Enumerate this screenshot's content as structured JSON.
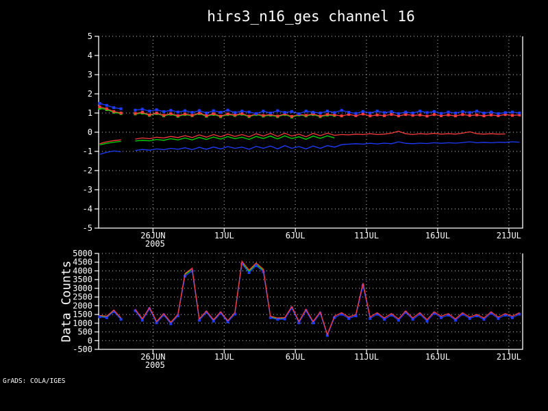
{
  "title": "hirs3_n16_ges channel 16",
  "credit": "GrADS: COLA/IGES",
  "colors": {
    "background": "#000000",
    "foreground": "#ffffff",
    "grid": "#c8c8c8",
    "red": "#fa3c3c",
    "green": "#00dc00",
    "blue": "#1e3cff"
  },
  "chart_data": [
    {
      "type": "line",
      "title": "hirs3_n16_ges channel 16",
      "panel": "top",
      "grid": true,
      "legend": "none",
      "x_axis": {
        "tick_labels": [
          "26JUN",
          "1JUL",
          "6JUL",
          "11JUL",
          "16JUL",
          "21JUL"
        ],
        "tick_times": [
          0,
          5,
          10,
          15,
          20,
          25
        ],
        "year_label": "2005",
        "t_start": -3.75,
        "dt": 0.5
      },
      "y_axis": {
        "min": -5,
        "max": 5,
        "step": 1,
        "label": ""
      },
      "series": [
        {
          "name": "green-lower-line",
          "color": "#00dc00",
          "markers": false,
          "values": [
            -0.66,
            -0.58,
            -0.52,
            -0.48,
            null,
            -0.46,
            -0.42,
            -0.45,
            -0.38,
            -0.42,
            -0.34,
            -0.4,
            -0.3,
            -0.4,
            -0.27,
            -0.38,
            -0.25,
            -0.36,
            -0.23,
            -0.34,
            -0.26,
            -0.38,
            -0.22,
            -0.33,
            -0.2,
            -0.35,
            -0.19,
            -0.33,
            -0.24,
            -0.37,
            -0.2,
            -0.32,
            -0.19,
            -0.3
          ]
        },
        {
          "name": "red-lower-line",
          "color": "#fa3c3c",
          "markers": false,
          "values": [
            -0.6,
            -0.5,
            -0.44,
            -0.4,
            null,
            -0.36,
            -0.3,
            -0.34,
            -0.26,
            -0.3,
            -0.22,
            -0.28,
            -0.18,
            -0.28,
            -0.14,
            -0.26,
            -0.12,
            -0.24,
            -0.1,
            -0.22,
            -0.12,
            -0.24,
            -0.08,
            -0.2,
            -0.06,
            -0.22,
            -0.05,
            -0.2,
            -0.1,
            -0.24,
            -0.06,
            -0.18,
            -0.05,
            -0.16,
            -0.12,
            -0.14,
            -0.1,
            -0.12,
            -0.08,
            -0.12,
            -0.1,
            -0.05,
            0.05,
            -0.08,
            -0.12,
            -0.08,
            -0.1,
            -0.06,
            -0.1,
            -0.08,
            -0.1,
            -0.05,
            0.02,
            -0.08,
            -0.1,
            -0.08,
            -0.1,
            -0.09
          ]
        },
        {
          "name": "blue-lower-line",
          "color": "#1e3cff",
          "markers": false,
          "values": [
            -1.15,
            -1.05,
            -0.98,
            -1.02,
            null,
            -0.95,
            -0.9,
            -0.94,
            -0.87,
            -0.91,
            -0.84,
            -0.89,
            -0.81,
            -0.91,
            -0.79,
            -0.89,
            -0.77,
            -0.87,
            -0.75,
            -0.84,
            -0.78,
            -0.89,
            -0.74,
            -0.84,
            -0.72,
            -0.87,
            -0.7,
            -0.84,
            -0.75,
            -0.87,
            -0.72,
            -0.84,
            -0.7,
            -0.78,
            -0.65,
            -0.62,
            -0.6,
            -0.62,
            -0.58,
            -0.61,
            -0.57,
            -0.6,
            -0.5,
            -0.58,
            -0.6,
            -0.57,
            -0.59,
            -0.55,
            -0.58,
            -0.55,
            -0.57,
            -0.54,
            -0.5,
            -0.55,
            -0.53,
            -0.55,
            -0.52,
            -0.53,
            -0.5,
            -0.52
          ]
        },
        {
          "name": "green-upper-line",
          "color": "#00dc00",
          "markers": true,
          "values": [
            1.25,
            1.18,
            1.04,
            0.97,
            null,
            0.95,
            1.0,
            0.88,
            0.97,
            0.85,
            0.94,
            0.83,
            0.92,
            0.86,
            0.97,
            0.83,
            0.93,
            0.81,
            0.92,
            0.87,
            0.94,
            0.81,
            0.92,
            0.84,
            0.89,
            0.81,
            0.92,
            0.79,
            0.9,
            0.85,
            0.92,
            0.81,
            0.89,
            0.87
          ]
        },
        {
          "name": "red-upper-line",
          "color": "#fa3c3c",
          "markers": true,
          "values": [
            1.32,
            1.22,
            1.08,
            1.0,
            null,
            0.98,
            1.04,
            0.9,
            1.0,
            0.88,
            0.97,
            0.86,
            0.95,
            0.88,
            1.0,
            0.86,
            0.96,
            0.84,
            0.95,
            0.9,
            0.97,
            0.84,
            0.95,
            0.87,
            0.92,
            0.84,
            0.95,
            0.82,
            0.93,
            0.88,
            0.95,
            0.84,
            0.92,
            0.9,
            0.85,
            0.93,
            0.86,
            0.95,
            0.85,
            0.9,
            0.86,
            0.93,
            0.85,
            0.92,
            0.88,
            0.9,
            0.84,
            0.92,
            0.86,
            0.9,
            0.85,
            0.92,
            0.87,
            0.9,
            0.85,
            0.9,
            0.86,
            0.92,
            0.88,
            0.9
          ]
        },
        {
          "name": "blue-upper-line",
          "color": "#1e3cff",
          "markers": true,
          "values": [
            1.5,
            1.4,
            1.28,
            1.22,
            null,
            1.15,
            1.2,
            1.1,
            1.17,
            1.07,
            1.14,
            1.05,
            1.12,
            1.03,
            1.13,
            1.0,
            1.12,
            1.04,
            1.15,
            1.02,
            1.1,
            1.05,
            0.97,
            1.1,
            1.0,
            1.12,
            1.03,
            1.08,
            0.96,
            1.1,
            1.04,
            1.0,
            1.1,
            1.02,
            1.14,
            1.04,
            0.98,
            1.08,
            1.0,
            1.1,
            1.02,
            1.07,
            0.97,
            1.05,
            1.0,
            1.1,
            1.02,
            1.08,
            0.98,
            1.05,
            1.0,
            1.07,
            1.02,
            1.1,
            1.0,
            1.05,
            0.97,
            1.02,
            1.05,
            1.0
          ]
        }
      ]
    },
    {
      "type": "line",
      "title": "",
      "panel": "bottom",
      "grid": true,
      "legend": "none",
      "x_axis": {
        "tick_labels": [
          "26JUN",
          "1JUL",
          "6JUL",
          "11JUL",
          "16JUL",
          "21JUL"
        ],
        "tick_times": [
          0,
          5,
          10,
          15,
          20,
          25
        ],
        "year_label": "2005",
        "t_start": -3.75,
        "dt": 0.5
      },
      "y_axis": {
        "min": -500,
        "max": 5000,
        "step": 500,
        "label": "Data Counts"
      },
      "series": [
        {
          "name": "green-counts-line",
          "color": "#00dc00",
          "markers": false,
          "values": [
            1410,
            1360,
            1710,
            1260,
            null,
            1760,
            1210,
            1860,
            1060,
            1510,
            1010,
            1460,
            3790,
            4080,
            1210,
            1660,
            1160,
            1610,
            1110,
            1560,
            4480,
            3980,
            4380,
            4030,
            1360,
            1260,
            1280,
            1910,
            1060,
            1760,
            1060,
            1610,
            320,
            1360
          ]
        },
        {
          "name": "blue-counts-line",
          "color": "#1e3cff",
          "markers": true,
          "values": [
            1370,
            1320,
            1670,
            1220,
            null,
            1720,
            1170,
            1820,
            1020,
            1470,
            970,
            1420,
            3700,
            4000,
            1170,
            1620,
            1120,
            1570,
            1070,
            1520,
            4400,
            3900,
            4300,
            3950,
            1320,
            1220,
            1240,
            1870,
            1020,
            1720,
            1020,
            1570,
            300,
            1320,
            1520,
            1270,
            1420,
            3150,
            1270,
            1520,
            1220,
            1470,
            1170,
            1620,
            1220,
            1520,
            1120,
            1570,
            1320,
            1470,
            1170,
            1520,
            1270,
            1420,
            1220,
            1570,
            1270,
            1470,
            1320,
            1520
          ]
        },
        {
          "name": "red-counts-line",
          "color": "#fa3c3c",
          "markers": false,
          "values": [
            1450,
            1400,
            1750,
            1300,
            null,
            1800,
            1250,
            1900,
            1100,
            1550,
            1050,
            1500,
            3850,
            4150,
            1250,
            1700,
            1200,
            1650,
            1150,
            1600,
            4550,
            4050,
            4450,
            4100,
            1400,
            1300,
            1320,
            1950,
            1100,
            1800,
            1100,
            1650,
            350,
            1400,
            1600,
            1350,
            1500,
            3300,
            1350,
            1600,
            1300,
            1550,
            1250,
            1700,
            1300,
            1600,
            1200,
            1650,
            1400,
            1550,
            1250,
            1600,
            1350,
            1500,
            1300,
            1650,
            1350,
            1550,
            1400,
            1600
          ]
        }
      ]
    }
  ]
}
